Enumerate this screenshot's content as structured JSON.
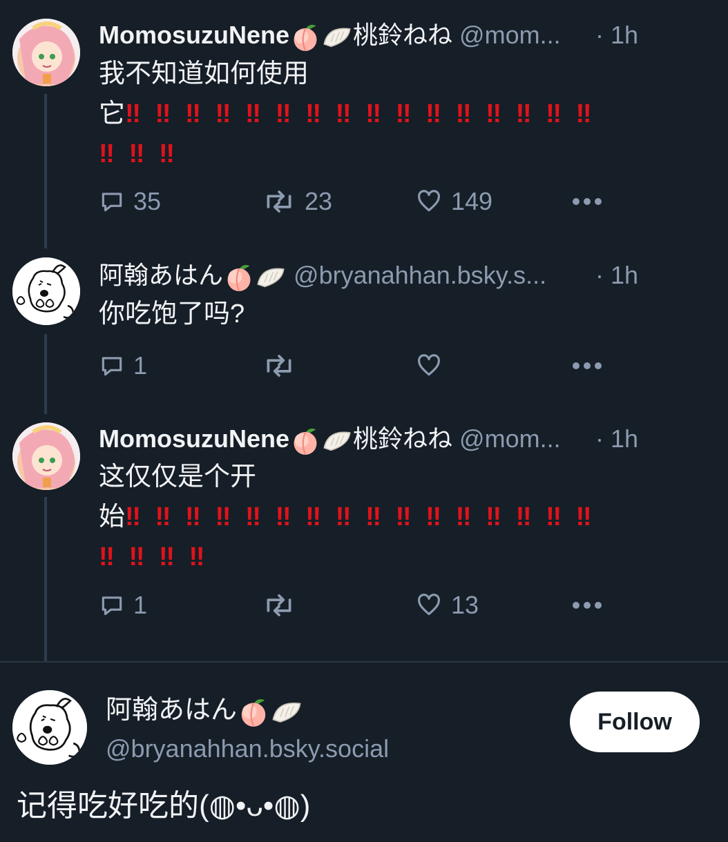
{
  "posts": [
    {
      "author": "MomosuzuNene",
      "display_jp": "桃鈴ねね",
      "handle": "@mom...",
      "time": "· 1h",
      "text_line1": "我不知道如何使用",
      "text_line2": "它",
      "bangs_line2": "‼ ‼ ‼ ‼ ‼ ‼ ‼ ‼ ‼ ‼ ‼ ‼ ‼ ‼ ‼ ‼",
      "bangs_line3": "‼ ‼ ‼",
      "replies": "35",
      "reposts": "23",
      "likes": "149"
    },
    {
      "author": "阿翰あはん",
      "handle": "@bryanahhan.bsky.s...",
      "time": "· 1h",
      "text_line1": "你吃饱了吗?",
      "replies": "1",
      "reposts": "",
      "likes": ""
    },
    {
      "author": "MomosuzuNene",
      "display_jp": "桃鈴ねね",
      "handle": "@mom...",
      "time": "· 1h",
      "text_line1": "这仅仅是个开",
      "text_line2": "始",
      "bangs_line2": "‼ ‼ ‼ ‼ ‼ ‼ ‼ ‼ ‼ ‼ ‼ ‼ ‼ ‼ ‼ ‼",
      "bangs_line3": "‼ ‼ ‼ ‼",
      "replies": "1",
      "reposts": "",
      "likes": "13"
    }
  ],
  "main_post": {
    "author": "阿翰あはん",
    "handle": "@bryanahhan.bsky.social",
    "follow_label": "Follow",
    "text": "记得吃好吃的(◍•ᴗ•◍)"
  },
  "icons": {
    "reply": "reply-icon",
    "repost": "repost-icon",
    "like": "heart-icon",
    "more": "more-icon",
    "peach": "peach-emoji-icon",
    "dumpling": "dumpling-emoji-icon"
  },
  "colors": {
    "background": "#161e27",
    "text": "#f1f3f5",
    "muted": "#8c9bb0",
    "bangs": "#e0121b",
    "thread_line": "#2e3c4e"
  }
}
